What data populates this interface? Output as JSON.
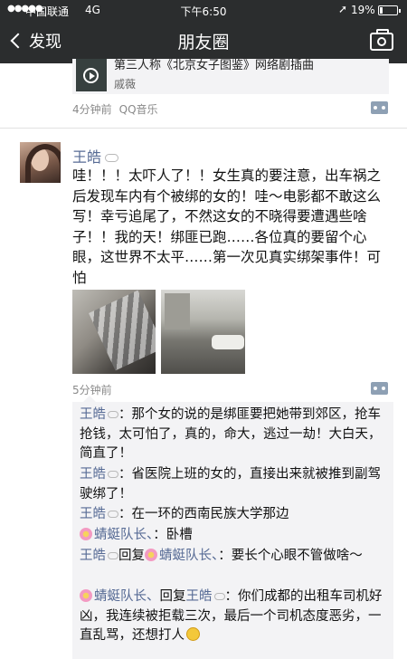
{
  "status_bar": {
    "carrier": "中国联通",
    "network": "4G",
    "time": "下午6:50",
    "battery": "19%",
    "battery_level": 0.19
  },
  "nav": {
    "back_label": "发现",
    "title": "朋友圈"
  },
  "prev_post": {
    "shared_title": "第三人称《北京女子图鉴》网络剧插曲",
    "shared_artist": "戚薇",
    "time": "4分钟前",
    "source": "QQ音乐"
  },
  "post": {
    "author": "王皓",
    "text": "哇！！！太吓人了！！女生真的要注意，出车祸之后发现车内有个被绑的女的！哇～电影都不敢这么写！幸亏追尾了，不然这女的不晓得要遭遇些啥子！！我的天！绑匪已跑……各位真的要留个心眼，这世界不太平……第一次见真实绑架事件！可怕",
    "time": "5分钟前"
  },
  "comments": [
    {
      "name": "王皓",
      "text": "：那个女的说的是绑匪要把她带到郊区，抢车抢钱，太可怕了，真的，命大，逃过一劫！大白天，简直了！"
    },
    {
      "name": "王皓",
      "text": "：省医院上班的女的，直接出来就被推到副驾驶绑了！"
    },
    {
      "name": "王皓",
      "text": "：在一环的西南民族大学那边"
    },
    {
      "name": "蜻蜓队长、",
      "text": "：卧槽"
    },
    {
      "name": "王皓",
      "reply_word": "回复",
      "reply_to": "蜻蜓队长、",
      "text": "：要长个心眼不管做啥～"
    },
    {
      "name": "蜻蜓队长、",
      "reply_word": "回复",
      "reply_to": "王皓",
      "text": "：你们成都的出租车司机好凶，我连续被拒载三次，最后一个司机态度恶劣，一直乱骂，还想打人"
    }
  ],
  "icons": {
    "back": "chevron-left-icon",
    "camera": "camera-icon",
    "more": "more-dots-icon",
    "play": "play-icon"
  }
}
